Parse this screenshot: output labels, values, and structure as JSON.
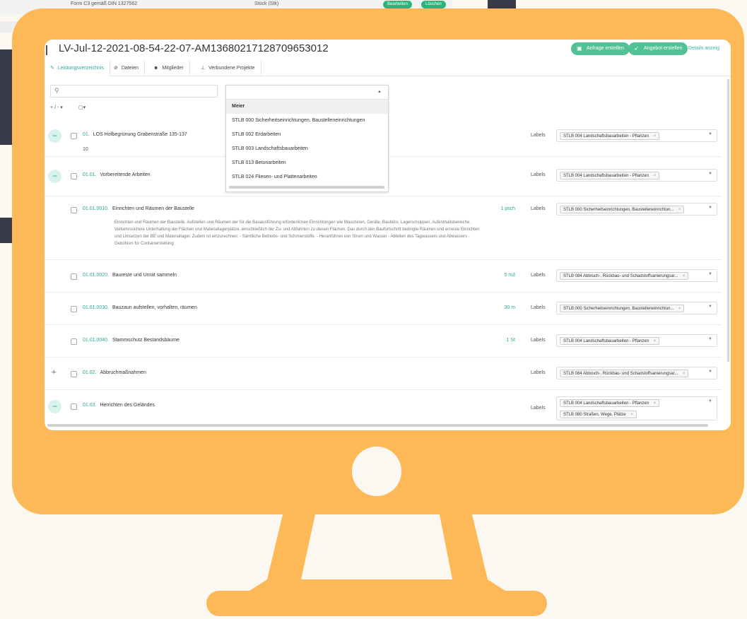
{
  "background": {
    "row_text": "Form C3 gemäß DIN 1327562",
    "row_unit": "Stück (Stk)",
    "edit_label": "Bearbeiten",
    "delete_label": "Löschen"
  },
  "header": {
    "title": "LV-Jul-12-2021-08-54-22-07-AM136802171287096530​12",
    "btn_anfrage": "Anfrage erstellen",
    "btn_angebot": "Angebot erstellen",
    "details_link": "Details anzeig"
  },
  "tabs": [
    {
      "label": "Leistungsverzeichnis",
      "icon": "pencil-icon"
    },
    {
      "label": "Dateien",
      "icon": "attachment-icon"
    },
    {
      "label": "Mitglieder",
      "icon": "users-icon"
    },
    {
      "label": "Verbundene Projekte",
      "icon": "sitemap-icon"
    }
  ],
  "toolbar": {
    "search_placeholder": "",
    "expand_toggle": "+ / -",
    "check_toggle": "▢▾"
  },
  "dropdown": {
    "options": [
      "Meier",
      "STLB 000 Sicherheitseinrichtungen, Baustelleneinrichtungen",
      "STLB 002 Erdarbeiten",
      "STLB 003 Landschaftsbauarbeiten",
      "STLB 013 Betonarbeiten",
      "STLB 024 Fliesen- und Plattenarbeiten"
    ]
  },
  "rows": [
    {
      "num": "01.",
      "title": "LOS Hofbegrünung Grabenstraße 135-137",
      "sub": "10",
      "qty": "",
      "label": "Labels",
      "tag": "STLB 004 Landschaftsbauarbeiten - Pflanzen"
    },
    {
      "num": "01.01.",
      "title": "Vorbereitende Arbeiten",
      "qty": "",
      "label": "Labels",
      "tag": "STLB 004 Landschaftsbauarbeiten - Pflanzen"
    },
    {
      "num": "01.01.0010.",
      "title": "Einrichten und Räumen der Baustelle",
      "qty": "1 psch",
      "label": "Labels",
      "tag": "STLB 000 Sicherheitseinrichtungen, Baustelleneinrichtun...",
      "desc": "Einrichten und Räumen der Baustelle. Aufstellen und Räumen der für die Bauausführung erforderlichen Einrichtungen wie Maschinen, Geräte, Baubüro, Lagerschuppen, Aufenthaltsbereiche. Verkehrssichere Unterhaltung der Flächen und Materiallagerplätze, einschließlich der Zu- und Abfahrten zu diesen Flächen. Das durch den Baufortschritt bedingte Räumen und erneute Einrichten und Umsetzen der BE und Materiallager. Zudem ist einzurechnen: - Sämtliche Betriebs- und Schmierstoffe. - Heranführen von Strom und Wasser - Ableiten des Tagwassers und Abwassers - Gebühren für Containerstellung"
    },
    {
      "num": "01.01.0020.",
      "title": "Baureste und Unrat sammeln",
      "qty": "5 m3",
      "label": "Labels",
      "tag": "STLB 084 Abbruch-, Rückbau- und Schadstoffsanierungsar..."
    },
    {
      "num": "01.01.0030.",
      "title": "Bauzaun aufstellen, vorhalten, räumen",
      "qty": "30 m",
      "label": "Labels",
      "tag": "STLB 000 Sicherheitseinrichtungen, Baustelleneinrichtun..."
    },
    {
      "num": "01.01.0040.",
      "title": "Stammschutz Bestandsbäume",
      "qty": "1 St",
      "label": "Labels",
      "tag": "STLB 004 Landschaftsbauarbeiten - Pflanzen"
    },
    {
      "num": "01.02.",
      "title": "Abbruchmaßnahmen",
      "qty": "",
      "label": "Labels",
      "tag": "STLB 084 Abbruch-, Rückbau- und Schadstoffsanierungsar..."
    },
    {
      "num": "01.03.",
      "title": "Herrichten des Geländes",
      "qty": "",
      "label": "Labels",
      "tag": "STLB 004 Landschaftsbauarbeiten - Pflanzen",
      "tag2": "STLB 080 Straßen, Wege, Plätze"
    }
  ],
  "colors": {
    "monitor": "#fdb957",
    "accent": "#2aa59a",
    "button": "#52c196",
    "background": "#fbf8f1"
  }
}
